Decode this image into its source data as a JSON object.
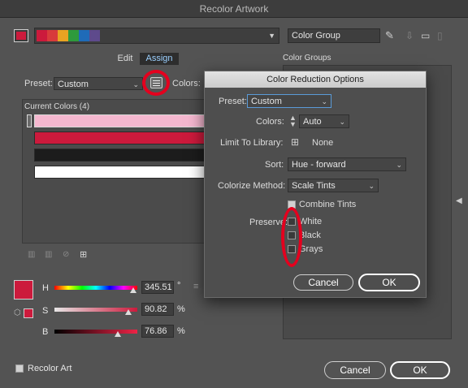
{
  "window": {
    "title": "Recolor Artwork"
  },
  "toolbar": {
    "group_name": "Color Group",
    "swatch_colors": [
      "#cc1a3c",
      "#d83b3b",
      "#e8a322",
      "#2e9a3c",
      "#1f6bb8",
      "#5e4a8c"
    ]
  },
  "tabs": {
    "edit": "Edit",
    "assign": "Assign"
  },
  "preset": {
    "label": "Preset:",
    "value": "Custom"
  },
  "colors_label": "Colors:",
  "current_colors": {
    "label": "Current Colors (4)",
    "rows": [
      "#f5b7cf",
      "#cc1a3c",
      "#1c1c1c",
      "#ffffff"
    ]
  },
  "color_groups_label": "Color Groups",
  "sliders": {
    "h": {
      "label": "H",
      "value": "345.51",
      "unit": "°"
    },
    "s": {
      "label": "S",
      "value": "90.82",
      "unit": "%"
    },
    "b": {
      "label": "B",
      "value": "76.86",
      "unit": "%"
    },
    "active_color": "#cc1a3c"
  },
  "recolor_art": {
    "label": "Recolor Art",
    "checked": true
  },
  "main_buttons": {
    "cancel": "Cancel",
    "ok": "OK"
  },
  "dialog": {
    "title": "Color Reduction Options",
    "preset_label": "Preset:",
    "preset_value": "Custom",
    "colors_label": "Colors:",
    "colors_value": "Auto",
    "library_label": "Limit To Library:",
    "library_value": "None",
    "sort_label": "Sort:",
    "sort_value": "Hue - forward",
    "colorize_label": "Colorize Method:",
    "colorize_value": "Scale Tints",
    "combine_tints": "Combine Tints",
    "preserve_label": "Preserve:",
    "preserve_items": [
      "White",
      "Black",
      "Grays"
    ],
    "cancel": "Cancel",
    "ok": "OK"
  }
}
